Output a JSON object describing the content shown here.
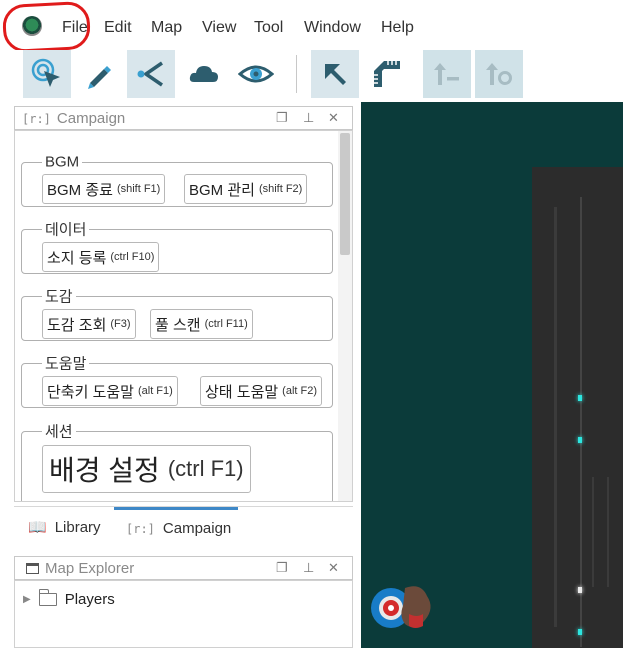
{
  "menubar": {
    "items": [
      "File",
      "Edit",
      "Map",
      "View",
      "Tool",
      "Window",
      "Help"
    ]
  },
  "toolbar": {
    "buttons": [
      "pointer-select-icon",
      "draw-tool-icon",
      "vision-blocking-icon",
      "fog-icon",
      "visibility-icon",
      "move-arrow-icon",
      "measure-icon",
      "move-up-icon",
      "move-to-icon"
    ]
  },
  "campaign_panel": {
    "bracket": "[r:]",
    "title": "Campaign",
    "groups": [
      {
        "label": "BGM",
        "buttons": [
          {
            "label": "BGM 종료",
            "shortcut": "(shift F1)"
          },
          {
            "label": "BGM 관리",
            "shortcut": "(shift F2)"
          }
        ]
      },
      {
        "label": "데이터",
        "buttons": [
          {
            "label": "소지 등록",
            "shortcut": "(ctrl F10)"
          }
        ]
      },
      {
        "label": "도감",
        "buttons": [
          {
            "label": "도감 조회",
            "shortcut": "(F3)"
          },
          {
            "label": "풀 스캔",
            "shortcut": "(ctrl F11)"
          }
        ]
      },
      {
        "label": "도움말",
        "buttons": [
          {
            "label": "단축키 도움말",
            "shortcut": "(alt F1)"
          },
          {
            "label": "상태 도움말",
            "shortcut": "(alt F2)"
          }
        ]
      },
      {
        "label": "세션",
        "buttons": [
          {
            "label": "배경 설정",
            "shortcut": "(ctrl F1)"
          }
        ]
      }
    ]
  },
  "tabs": [
    {
      "label": "Library",
      "icon": "book-icon"
    },
    {
      "label": "Campaign",
      "icon": "[r:]"
    }
  ],
  "map_explorer": {
    "title": "Map Explorer",
    "tree": [
      {
        "label": "Players"
      }
    ]
  },
  "colors": {
    "accent": "#3e88c7",
    "map_bg": "#0b3b3a",
    "highlight": "#e01b1b"
  }
}
